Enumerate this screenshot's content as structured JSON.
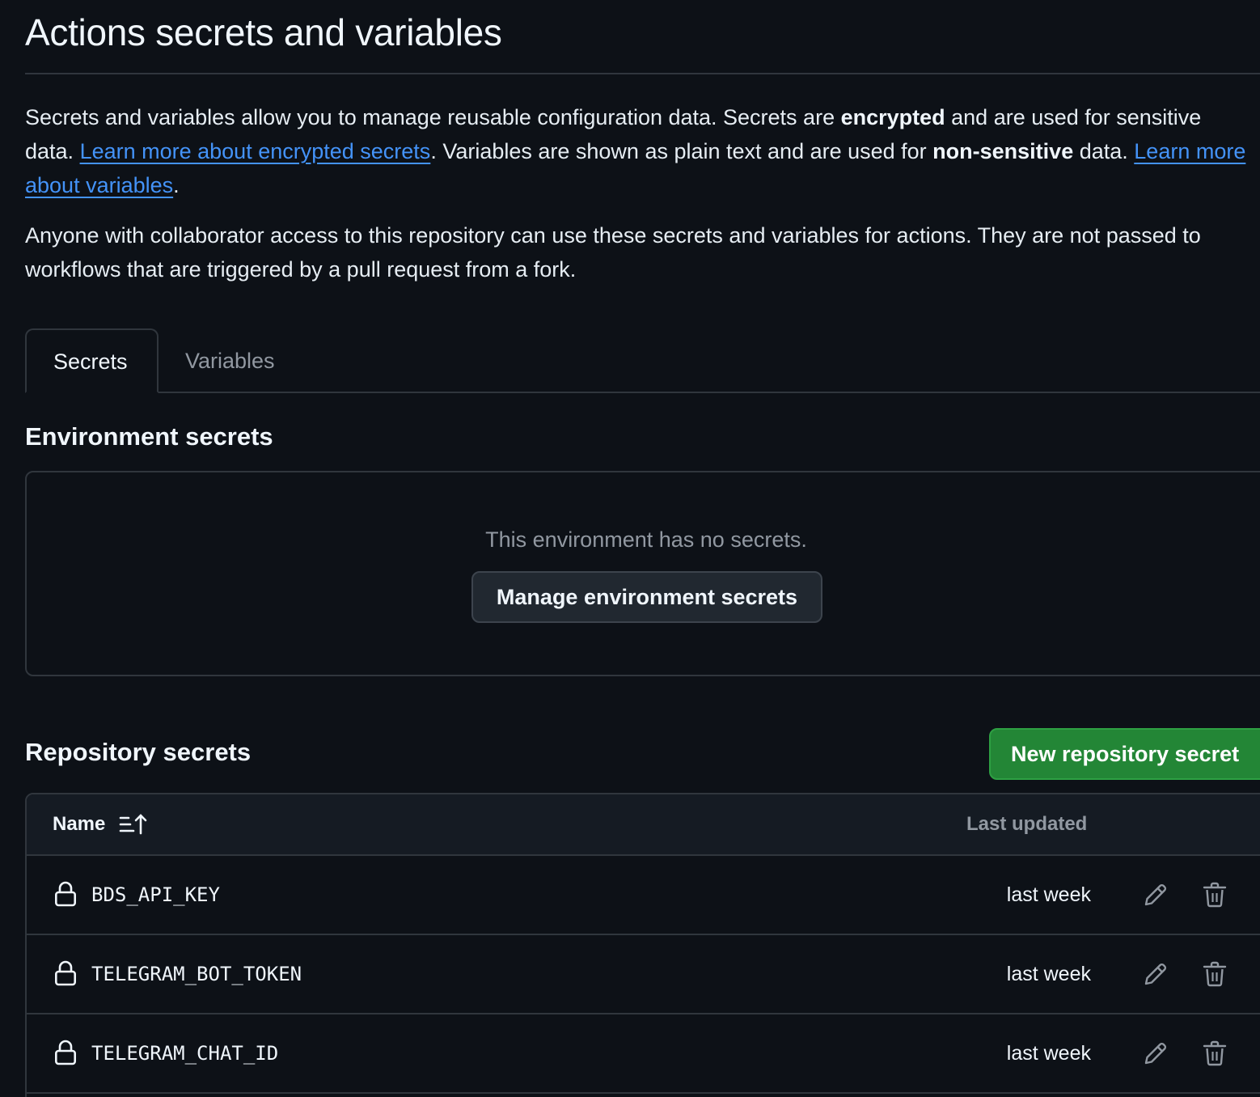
{
  "page": {
    "title": "Actions secrets and variables"
  },
  "intro": {
    "part1": "Secrets and variables allow you to manage reusable configuration data. Secrets are ",
    "bold1": "encrypted",
    "part2": " and are used for sensitive data. ",
    "link1": "Learn more about encrypted secrets",
    "part3": ". Variables are shown as plain text and are used for ",
    "bold2": "non-sensitive",
    "part4": " data. ",
    "link2": "Learn more about variables",
    "part5": "."
  },
  "note": "Anyone with collaborator access to this repository can use these secrets and variables for actions. They are not passed to workflows that are triggered by a pull request from a fork.",
  "tabs": [
    {
      "label": "Secrets",
      "active": true
    },
    {
      "label": "Variables",
      "active": false
    }
  ],
  "environment": {
    "title": "Environment secrets",
    "empty_text": "This environment has no secrets.",
    "manage_button": "Manage environment secrets"
  },
  "repository": {
    "title": "Repository secrets",
    "new_button": "New repository secret",
    "table": {
      "columns": {
        "name": "Name",
        "last_updated": "Last updated"
      },
      "rows": [
        {
          "name": "BDS_API_KEY",
          "updated": "last week"
        },
        {
          "name": "TELEGRAM_BOT_TOKEN",
          "updated": "last week"
        },
        {
          "name": "TELEGRAM_CHAT_ID",
          "updated": "last week"
        }
      ]
    }
  },
  "icons": {
    "sort": "sort-ascending-icon",
    "lock": "lock-icon",
    "edit": "pencil-icon",
    "delete": "trash-icon"
  },
  "colors": {
    "background": "#0d1117",
    "link": "#4493f8",
    "primary_button": "#238636",
    "border": "#30363d",
    "muted_text": "#9198a1"
  }
}
